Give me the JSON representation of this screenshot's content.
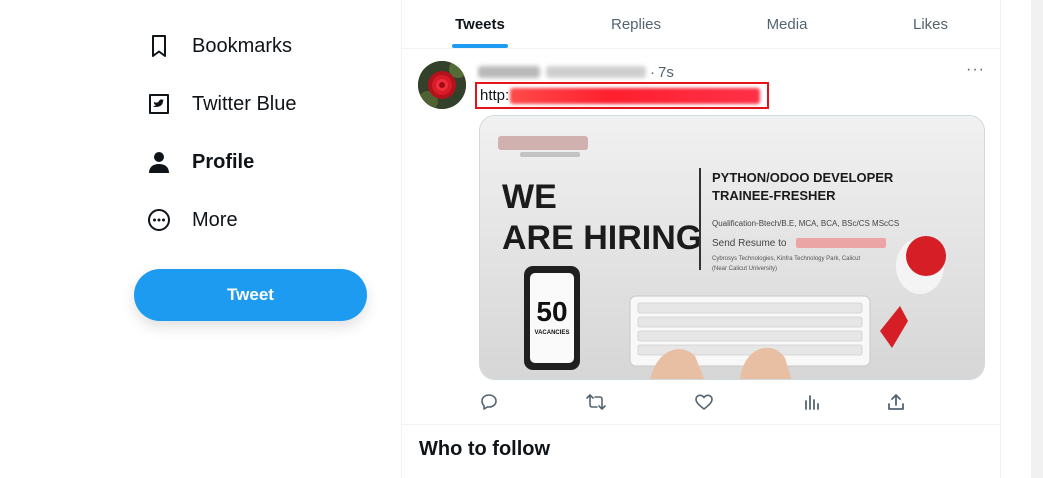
{
  "nav": {
    "items": [
      {
        "label": "Bookmarks",
        "icon": "bookmark-icon"
      },
      {
        "label": "Twitter Blue",
        "icon": "twitter-blue-icon"
      },
      {
        "label": "Profile",
        "icon": "profile-icon",
        "active": true
      },
      {
        "label": "More",
        "icon": "more-circle-icon"
      }
    ],
    "tweet_button": "Tweet"
  },
  "tabs": [
    {
      "label": "Tweets",
      "active": true
    },
    {
      "label": "Replies"
    },
    {
      "label": "Media"
    },
    {
      "label": "Likes"
    }
  ],
  "tweet": {
    "separator": "·",
    "time": "7s",
    "link_prefix": "http:",
    "more": "···",
    "media": {
      "headline_1": "WE",
      "headline_2": "ARE HIRING",
      "role_1": "PYTHON/ODOO DEVELOPER",
      "role_2": "TRAINEE-FRESHER",
      "qualification": "Qualification-Btech/B.E, MCA, BCA, BSc/CS MScCS",
      "send_resume": "Send Resume to",
      "address_1": "Cybrosys Technologies,  Kinfra Technology Park, Calicut",
      "address_2": "(Near Calicut University)",
      "vacancies_count": "50",
      "vacancies_label": "VACANCIES"
    },
    "actions": [
      "reply-icon",
      "retweet-icon",
      "like-icon",
      "analytics-icon",
      "share-icon"
    ]
  },
  "who_to_follow": "Who to follow",
  "colors": {
    "accent": "#1d9bf0",
    "text": "#0f1419",
    "muted": "#536471",
    "highlight_border": "#e5141b"
  }
}
